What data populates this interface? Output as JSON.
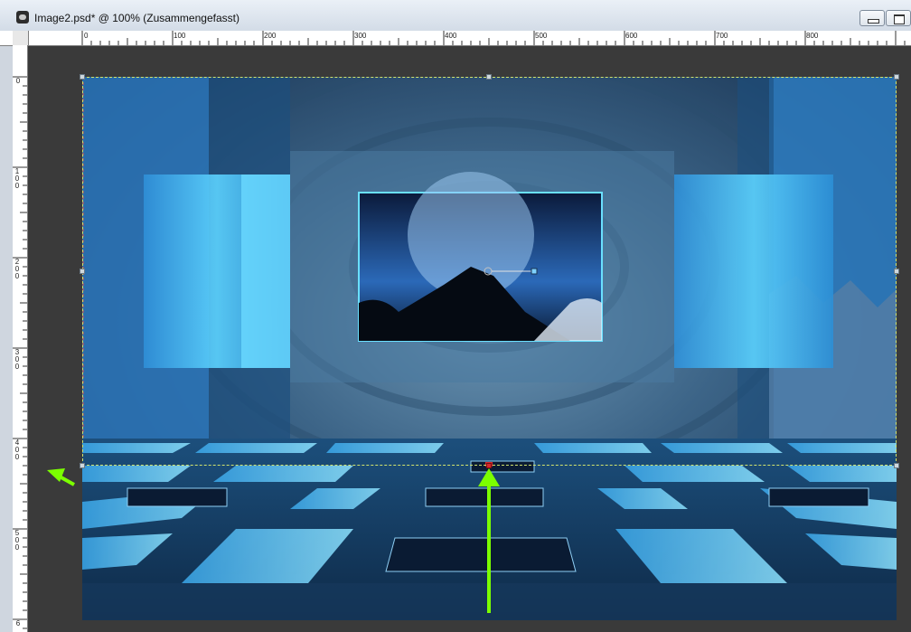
{
  "window": {
    "title": "Image2.psd* @ 100% (Zusammengefasst)",
    "app_icon": "photoshop-document-icon",
    "minimize_icon": "minimize-icon",
    "restore_icon": "restore-icon"
  },
  "ruler": {
    "horizontal_labels": [
      "0",
      "100",
      "200",
      "300",
      "400",
      "500",
      "600",
      "700",
      "800"
    ],
    "vertical_labels": [
      "0",
      "100",
      "200",
      "300",
      "400",
      "500",
      "6"
    ]
  },
  "canvas": {
    "description_icon": "layer-image-canvas",
    "accent": "#7cff00",
    "selection_color": "#d2e36d"
  },
  "annotations": {
    "arrow_up_icon": "green-arrow-up-icon",
    "arrow_left_icon": "green-arrow-left-icon"
  }
}
